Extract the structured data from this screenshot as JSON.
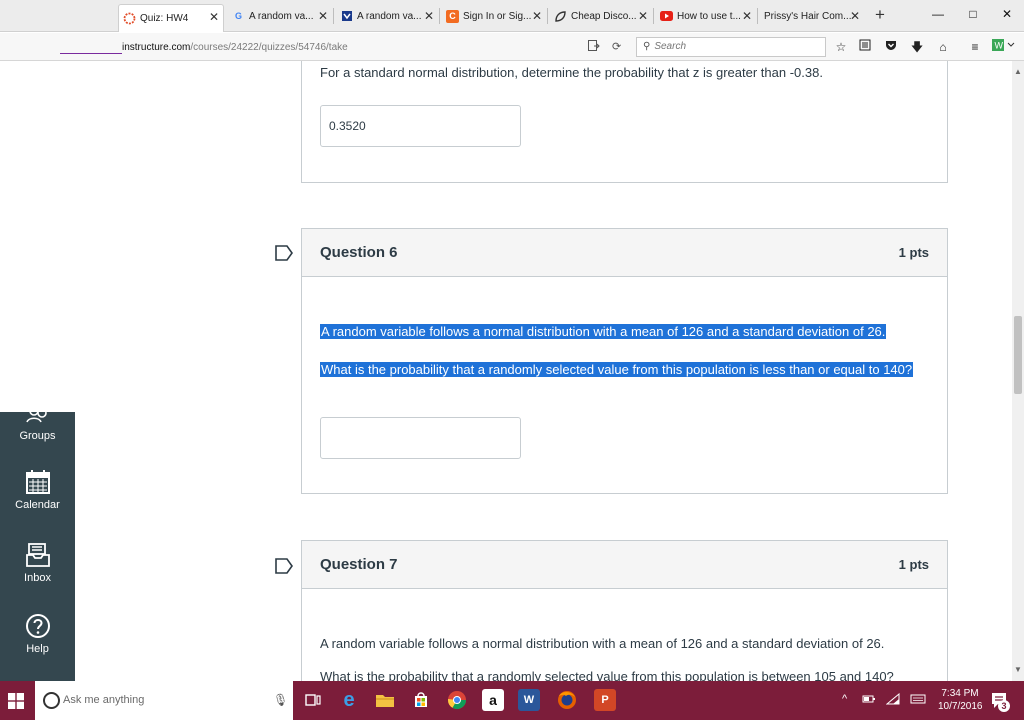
{
  "browser": {
    "tabs": [
      {
        "label": "Quiz: HW4",
        "icon": "canvas-icon",
        "color": "#e24e2a"
      },
      {
        "label": "A random va...",
        "icon": "google-icon",
        "color": "#4285f4"
      },
      {
        "label": "A random va...",
        "icon": "shield-icon",
        "color": "#1a3a8c"
      },
      {
        "label": "Sign In or Sig...",
        "icon": "chegg-icon",
        "color": "#f26b21"
      },
      {
        "label": "Cheap Disco...",
        "icon": "leaf-icon",
        "color": "#333333"
      },
      {
        "label": "How to use t...",
        "icon": "youtube-icon",
        "color": "#e62117"
      },
      {
        "label": "Prissy's Hair Com...",
        "icon": "blank-icon",
        "color": "#888888"
      }
    ],
    "new_tab": "+",
    "window_controls": {
      "minimize": "—",
      "maximize": "□",
      "close": "✕"
    },
    "url": {
      "host": "instructure.com",
      "path": "/courses/24222/quizzes/54746/take"
    },
    "search_placeholder": "Search"
  },
  "page": {
    "previous_question": {
      "text": "For a standard normal distribution, determine the probability that z is greater than -0.38.",
      "answer": "0.3520"
    },
    "question6": {
      "title": "Question 6",
      "points": "1 pts",
      "line1": "A random variable follows a normal distribution with a mean of 126 and a standard deviation of 26.",
      "line2": "What is the probability that a randomly selected value from this population is less than or equal to 140?",
      "answer": ""
    },
    "question7": {
      "title": "Question 7",
      "points": "1 pts",
      "line1": "A random variable follows a normal distribution with a mean of 126 and a standard deviation of 26.",
      "line2": "What is the probability that a randomly selected value from this population is between 105 and 140?"
    }
  },
  "sidebar": {
    "items": [
      {
        "label": "Groups",
        "icon": "groups-icon"
      },
      {
        "label": "Calendar",
        "icon": "calendar-icon"
      },
      {
        "label": "Inbox",
        "icon": "inbox-icon"
      },
      {
        "label": "Help",
        "icon": "help-icon"
      }
    ],
    "bg_color": "#34474f"
  },
  "taskbar": {
    "search_placeholder": "Ask me anything",
    "time": "7:34 PM",
    "date": "10/7/2016",
    "notification_count": "3",
    "bg_color": "#7c1d3a"
  }
}
